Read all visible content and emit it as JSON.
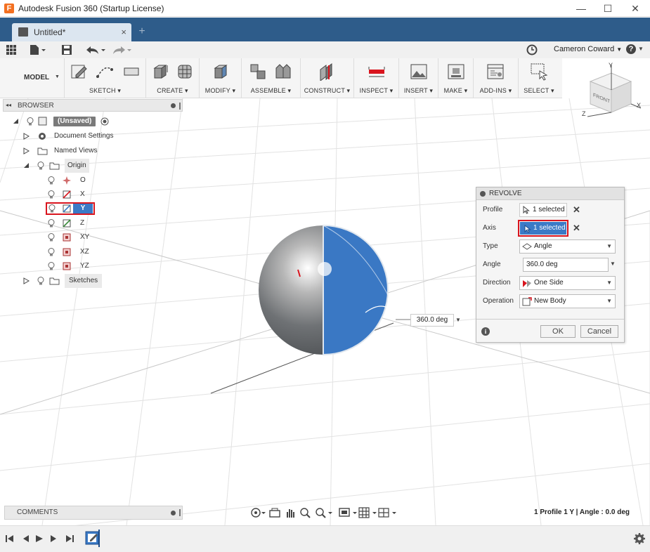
{
  "window": {
    "title": "Autodesk Fusion 360 (Startup License)",
    "minimize_glyph": "—",
    "maximize_glyph": "☐",
    "close_glyph": "✕"
  },
  "tab": {
    "name": "Untitled*",
    "close_glyph": "×",
    "new_tab_glyph": "+"
  },
  "quick_access": {
    "user": "Cameron Coward",
    "user_caret": "▼",
    "help_glyph": "?",
    "help_caret": "▼"
  },
  "toolbar": {
    "workspace": "MODEL",
    "workspace_caret": "▼",
    "groups": [
      {
        "label": "SKETCH ▾"
      },
      {
        "label": "CREATE ▾"
      },
      {
        "label": "MODIFY ▾"
      },
      {
        "label": "ASSEMBLE ▾"
      },
      {
        "label": "CONSTRUCT ▾"
      },
      {
        "label": "INSPECT ▾"
      },
      {
        "label": "INSERT ▾"
      },
      {
        "label": "MAKE ▾"
      },
      {
        "label": "ADD-INS ▾"
      },
      {
        "label": "SELECT ▾"
      }
    ]
  },
  "viewcube": {
    "face": "FRONT",
    "axis_x": "X",
    "axis_y": "Y",
    "axis_z": "Z"
  },
  "browser": {
    "title": "BROWSER",
    "collapse_glyph": "◂◂",
    "root": "(Unsaved)",
    "items": [
      {
        "label": "Document Settings"
      },
      {
        "label": "Named Views"
      },
      {
        "label": "Origin"
      },
      {
        "label": "O"
      },
      {
        "label": "X"
      },
      {
        "label": "Y"
      },
      {
        "label": "Z"
      },
      {
        "label": "XY"
      },
      {
        "label": "XZ"
      },
      {
        "label": "YZ"
      },
      {
        "label": "Sketches"
      }
    ]
  },
  "revolve": {
    "title": "REVOLVE",
    "rows": [
      {
        "label": "Profile",
        "value": "1 selected"
      },
      {
        "label": "Axis",
        "value": "1 selected"
      },
      {
        "label": "Type",
        "value": "Angle"
      },
      {
        "label": "Angle",
        "value": "360.0 deg"
      },
      {
        "label": "Direction",
        "value": "One Side"
      },
      {
        "label": "Operation",
        "value": "New Body"
      }
    ],
    "ok": "OK",
    "cancel": "Cancel",
    "info_glyph": "i",
    "clear_glyph": "✕"
  },
  "manipulator": {
    "value": "360.0 deg"
  },
  "comments": {
    "title": "COMMENTS"
  },
  "status": {
    "text": "1 Profile 1 Y | Angle : 0.0 deg"
  },
  "colors": {
    "tabbar": "#2e5c8a",
    "selection_blue": "#3b7ac6",
    "highlight_red": "#d9151e",
    "profile_blue": "#3a78c4"
  }
}
